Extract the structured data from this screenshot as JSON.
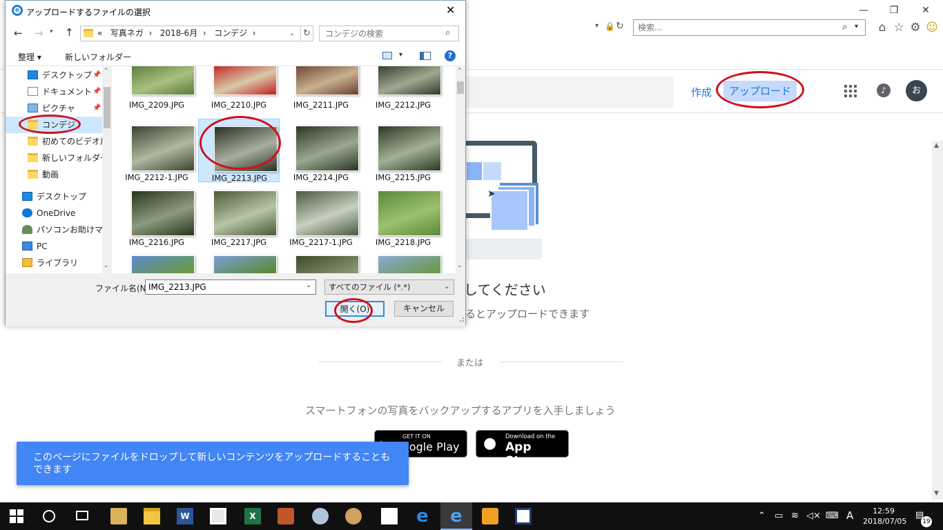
{
  "browser": {
    "search_placeholder": "検索...",
    "minimize": "—",
    "restore": "❐",
    "close": "✕"
  },
  "app_header": {
    "create_label": "作成",
    "upload_label": "アップロード",
    "avatar_letter": "お"
  },
  "main": {
    "drop_title": "してください",
    "drop_subtitle": "るとアップロードできます",
    "or_text": "または",
    "app_promo": "スマートフォンの写真をバックアップするアプリを入手しましょう",
    "google_play_small": "GET IT ON",
    "google_play_big": "oogle Play",
    "app_store_small": "Download on the",
    "app_store_big": "App Store",
    "toast": "このページにファイルをドロップして新しいコンテンツをアップロードすることもできます"
  },
  "dialog": {
    "title": "アップロードするファイルの選択",
    "breadcrumb": [
      "«",
      "写真ネガ",
      "2018-6月",
      "コンデジ"
    ],
    "search_placeholder": "コンデジの検索",
    "organize": "整理 ▾",
    "new_folder": "新しいフォルダー",
    "help": "?",
    "nav": [
      {
        "label": "デスクトップ",
        "icon": "desktop-icon",
        "pinned": true
      },
      {
        "label": "ドキュメント",
        "icon": "documents-icon",
        "pinned": true
      },
      {
        "label": "ピクチャ",
        "icon": "pictures-icon",
        "pinned": true
      },
      {
        "label": "コンデジ",
        "icon": "folder-icon",
        "selected": true
      },
      {
        "label": "初めてのビデオ用動",
        "icon": "folder-icon"
      },
      {
        "label": "新しいフォルダー",
        "icon": "folder-icon"
      },
      {
        "label": "動画",
        "icon": "folder-icon"
      },
      {
        "label": "デスクトップ",
        "icon": "desktop-icon"
      },
      {
        "label": "OneDrive",
        "icon": "cloud-icon"
      },
      {
        "label": "パソコンお助けマン",
        "icon": "user-icon"
      },
      {
        "label": "PC",
        "icon": "pc-icon"
      },
      {
        "label": "ライブラリ",
        "icon": "library-icon"
      }
    ],
    "files": [
      {
        "name": "IMG_2209.JPG",
        "c1": "#5a7a3a",
        "c2": "#a8c080"
      },
      {
        "name": "IMG_2210.JPG",
        "c1": "#c02020",
        "c2": "#d8c8a8"
      },
      {
        "name": "IMG_2211.JPG",
        "c1": "#6a4030",
        "c2": "#c8b090"
      },
      {
        "name": "IMG_2212.JPG",
        "c1": "#2e3a2a",
        "c2": "#a0a890"
      },
      {
        "name": "IMG_2212-1.JPG",
        "c1": "#3a4430",
        "c2": "#b0b8a0"
      },
      {
        "name": "IMG_2213.JPG",
        "c1": "#28321f",
        "c2": "#a8aea0",
        "selected": true
      },
      {
        "name": "IMG_2214.JPG",
        "c1": "#2a3624",
        "c2": "#9aa890"
      },
      {
        "name": "IMG_2215.JPG",
        "c1": "#2c3a26",
        "c2": "#a2b094"
      },
      {
        "name": "IMG_2216.JPG",
        "c1": "#28361e",
        "c2": "#8c9a80"
      },
      {
        "name": "IMG_2217.JPG",
        "c1": "#4a5a38",
        "c2": "#b8c4a8"
      },
      {
        "name": "IMG_2217-1.JPG",
        "c1": "#4a5a40",
        "c2": "#c8d0c0"
      },
      {
        "name": "IMG_2218.JPG",
        "c1": "#5a8a3a",
        "c2": "#9cc070"
      },
      {
        "name": "",
        "c1": "#5a8ad0",
        "c2": "#6a9a40"
      },
      {
        "name": "",
        "c1": "#7aa0d8",
        "c2": "#5a8a38"
      },
      {
        "name": "",
        "c1": "#3a4a2a",
        "c2": "#8a9870"
      },
      {
        "name": "",
        "c1": "#8aaad8",
        "c2": "#6a9a48"
      }
    ],
    "filename_label": "ファイル名(N):",
    "filename_value": "IMG_2213.JPG",
    "filter": "すべてのファイル (*.*)",
    "open": "開く(O)",
    "cancel": "キャンセル"
  },
  "taskbar": {
    "time": "12:59",
    "date": "2018/07/05",
    "ime": "A",
    "notifications": "19"
  },
  "colors": {
    "accent": "#1a73e8",
    "upload_bg": "#c6dafc",
    "annotation": "#d0101a",
    "toast": "#4285f4"
  }
}
